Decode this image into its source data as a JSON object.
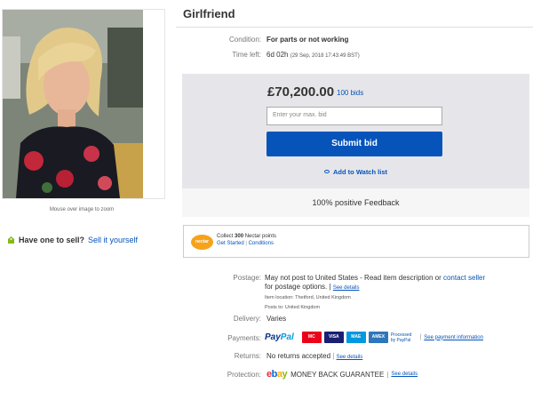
{
  "listing": {
    "title": "Girlfriend",
    "condition_label": "Condition:",
    "condition_value": "For parts or not working",
    "timeleft_label": "Time left:",
    "timeleft_value": "6d 02h",
    "timeleft_detail": "(29 Sep, 2018  17:43:49 BST)"
  },
  "gallery": {
    "zoom_hint": "Mouse over image to zoom"
  },
  "sell": {
    "question": "Have one to sell?",
    "link": "Sell it yourself"
  },
  "bid": {
    "price": "£70,200.00",
    "bids": "100 bids",
    "input_placeholder": "Enter your max. bid",
    "submit_label": "Submit bid",
    "watch_label": "Add to Watch list",
    "feedback": "100% positive Feedback"
  },
  "nectar": {
    "logo": "nectar",
    "line1_pre": "Collect ",
    "line1_points": "300",
    "line1_post": " Nectar points",
    "get_started": "Get Started",
    "sep": "|",
    "conditions": "Conditions"
  },
  "postage": {
    "label": "Postage:",
    "text_main": "May not post to United States - Read item description or ",
    "contact_link": "contact seller",
    "text_2": "for postage options.",
    "see_details": "See details",
    "item_location": "Item location:  Thetford, United Kingdom",
    "posts_to": "Posts to:  United Kingdom"
  },
  "delivery": {
    "label": "Delivery:",
    "value": "Varies"
  },
  "payments": {
    "label": "Payments:",
    "paypal_a": "Pay",
    "paypal_b": "Pal",
    "cards": [
      {
        "name": "mastercard",
        "text": "MC",
        "color": "#eb001b"
      },
      {
        "name": "visa",
        "text": "VISA",
        "color": "#1a1f71"
      },
      {
        "name": "maestro",
        "text": "MAE",
        "color": "#0099df"
      },
      {
        "name": "amex",
        "text": "AMEX",
        "color": "#2e77bb"
      }
    ],
    "processed_1": "Processed",
    "processed_2": "by PayPal",
    "see_payment": "See payment information"
  },
  "returns": {
    "label": "Returns:",
    "value": "No returns accepted",
    "see": "See details"
  },
  "protection": {
    "label": "Protection:",
    "ebay": [
      "e",
      "b",
      "a",
      "y"
    ],
    "ebay_colors": [
      "#e53238",
      "#0064d2",
      "#f5af02",
      "#86b817"
    ],
    "guarantee": "MONEY BACK GUARANTEE",
    "see": "See details"
  }
}
